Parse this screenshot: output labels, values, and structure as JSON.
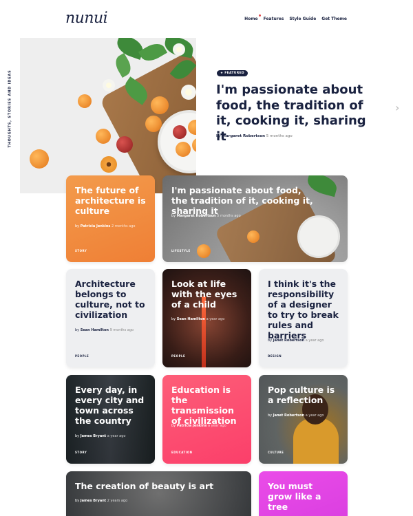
{
  "header": {
    "logo": "nunui",
    "nav": [
      "Home",
      "Features",
      "Style Guide",
      "Get Theme"
    ]
  },
  "sidebar": {
    "tagline": "THOUGHTS, STORIES AND IDEAS"
  },
  "hero": {
    "badge": "★ FEATURED",
    "title": "I'm passionate about food, the tradition of it, cooking it, sharing it",
    "author_prefix": "by",
    "author": "Margaret Robertson",
    "time": "5 months ago"
  },
  "cards": [
    {
      "title": "The future of architecture is culture",
      "author": "Patricia Jenkins",
      "time": "2 months ago",
      "category": "STORY",
      "bg": "#f0893e"
    },
    {
      "title": "I'm passionate about food, the tradition of it, cooking it, sharing it",
      "author": "Margaret Robertson",
      "time": "5 months ago",
      "category": "LIFESTYLE"
    },
    {
      "title": "Architecture belongs to culture, not to civilization",
      "author": "Sean Hamilton",
      "time": "9 months ago",
      "category": "PEOPLE"
    },
    {
      "title": "Look at life with the eyes of a child",
      "author": "Sean Hamilton",
      "time": "a year ago",
      "category": "PEOPLE"
    },
    {
      "title": "I think it's the responsibility of a designer to try to break rules and barriers",
      "author": "Janet Robertson",
      "time": "a year ago",
      "category": "DESIGN"
    },
    {
      "title": "Every day, in every city and town across the country",
      "author": "James Bryant",
      "time": "a year ago",
      "category": "STORY"
    },
    {
      "title": "Education is the transmission of civilization",
      "author": "Patricia Jenkins",
      "time": "a year ago",
      "category": "EDUCATION"
    },
    {
      "title": "Pop culture is a reflection",
      "author": "Janet Robertson",
      "time": "a year ago",
      "category": "CULTURE"
    },
    {
      "title": "The creation of beauty is art",
      "author": "James Bryant",
      "time": "2 years ago",
      "category": ""
    },
    {
      "title": "You must grow like a tree",
      "author": "",
      "time": "",
      "category": ""
    }
  ],
  "colors": {
    "accent_dark": "#1a2240",
    "orange": "#f0893e",
    "pink": "#fc4f6e",
    "magenta": "#e63fe4",
    "light_card": "#eeeff1"
  },
  "icons": {
    "next": "chevron-right-icon",
    "featured": "star-icon"
  }
}
